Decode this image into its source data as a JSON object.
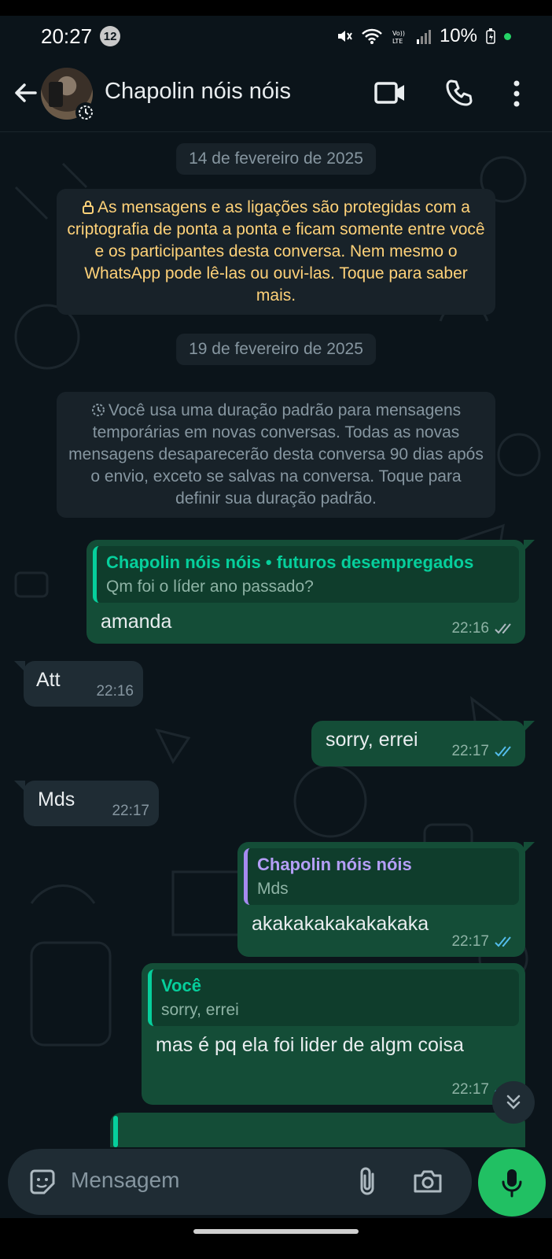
{
  "status_bar": {
    "time": "20:27",
    "notification_count": "12",
    "battery": "10%"
  },
  "header": {
    "contact_name": "Chapolin nóis nóis",
    "icons": [
      "back-arrow-icon",
      "video-call-icon",
      "phone-call-icon",
      "more-vertical-icon"
    ]
  },
  "chat": {
    "date_chips": [
      "14 de fevereiro de 2025",
      "19 de fevereiro de 2025"
    ],
    "encryption_notice": "As mensagens e as ligações são protegidas com a criptografia de ponta a ponta e ficam somente entre você e os participantes desta conversa. Nem mesmo o WhatsApp pode lê-las ou ouvi-las. Toque para saber mais.",
    "disappearing_notice": "Você usa uma duração padrão para mensagens temporárias em novas conversas. Todas as novas mensagens desaparecerão desta conversa 90 dias após o envio, exceto se salvas na conversa. Toque para definir sua duração padrão.",
    "messages": [
      {
        "direction": "out",
        "quote_name": "Chapolin nóis nóis • futuros desempregados",
        "quote_text": "Qm foi o líder ano passado?",
        "text": "amanda",
        "time": "22:16",
        "status": "delivered"
      },
      {
        "direction": "in",
        "text": "Att",
        "time": "22:16"
      },
      {
        "direction": "out",
        "text": "sorry, errei",
        "time": "22:17",
        "status": "read"
      },
      {
        "direction": "in",
        "text": "Mds",
        "time": "22:17"
      },
      {
        "direction": "out",
        "quote_name": "Chapolin nóis nóis",
        "quote_text": "Mds",
        "text": "akakakakakakakaka",
        "time": "22:17",
        "status": "read"
      },
      {
        "direction": "out",
        "quote_name": "Você",
        "quote_text": "sorry, errei",
        "text": "mas é pq ela foi lider de algm coisa",
        "time": "22:17",
        "status": "read"
      }
    ]
  },
  "composer": {
    "placeholder": "Mensagem"
  },
  "colors": {
    "background": "#0b141a",
    "outgoing_bubble": "#144d37",
    "incoming_bubble": "#1f2c34",
    "accent_green": "#21c063",
    "read_tick": "#53bdeb",
    "notice_yellow": "#ffd279"
  }
}
